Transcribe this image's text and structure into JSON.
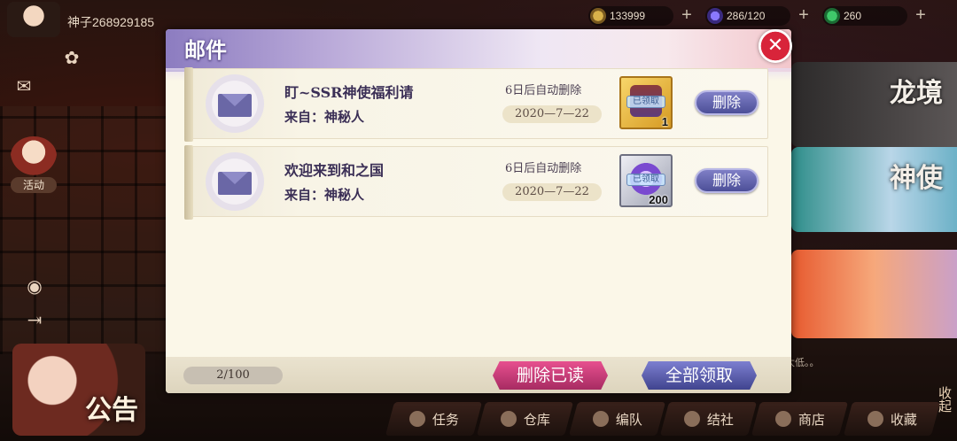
{
  "topbar": {
    "player_name": "神子268929185",
    "resources": [
      {
        "name": "coin",
        "value": "133999"
      },
      {
        "name": "stamina",
        "value": "286/120"
      },
      {
        "name": "gem",
        "value": "260"
      }
    ]
  },
  "side": {
    "activity_label": "活动",
    "notice_label": "公告"
  },
  "banners": [
    {
      "title": "龙境"
    },
    {
      "title": "神使"
    },
    {
      "title": ""
    }
  ],
  "chat_snippet": "…是概率太低。。",
  "collapse_label": "收起",
  "bottom_nav": [
    {
      "label": "任务"
    },
    {
      "label": "仓库"
    },
    {
      "label": "编队"
    },
    {
      "label": "结社"
    },
    {
      "label": "商店"
    },
    {
      "label": "收藏"
    }
  ],
  "mail_panel": {
    "title": "邮件",
    "mails": [
      {
        "title": "盯~SSR神使福利请",
        "from": "来自：神秘人",
        "expire": "6日后自动删除",
        "date": "2020—7—22",
        "reward_stamp": "已领取",
        "reward_qty": "1",
        "delete_label": "删除"
      },
      {
        "title": "欢迎来到和之国",
        "from": "来自：神秘人",
        "expire": "6日后自动删除",
        "date": "2020—7—22",
        "reward_stamp": "已领取",
        "reward_qty": "200",
        "delete_label": "删除"
      }
    ],
    "count": "2/100",
    "delete_read_label": "删除已读",
    "claim_all_label": "全部领取"
  }
}
